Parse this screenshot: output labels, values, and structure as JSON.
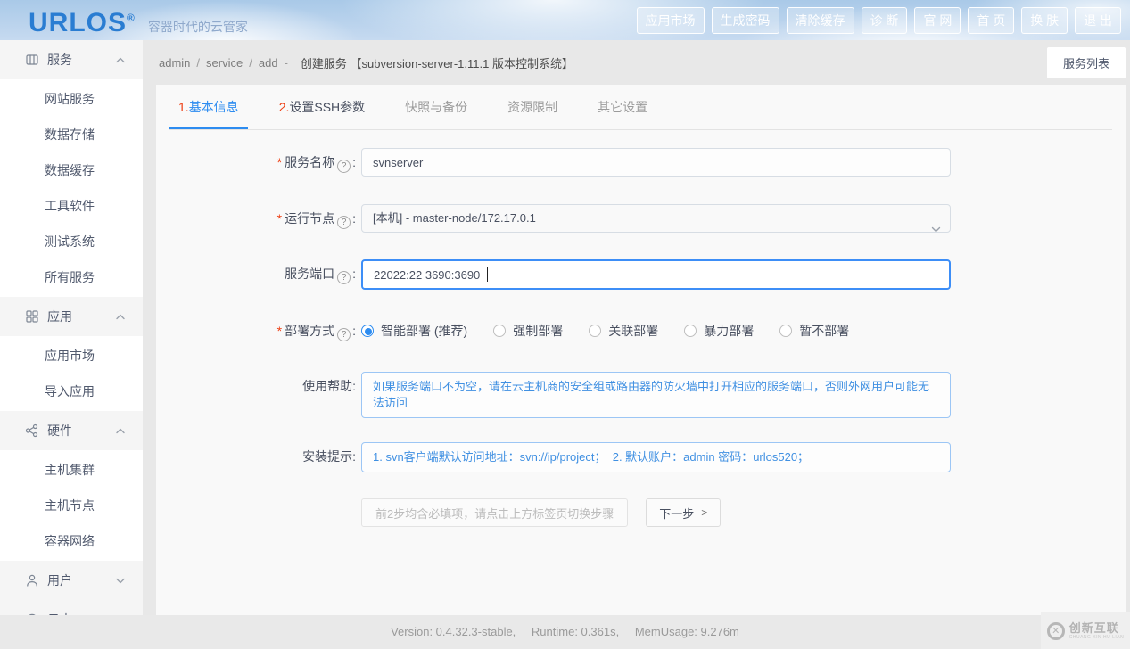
{
  "header": {
    "logo": "URLOS",
    "logo_reg": "®",
    "tagline": "容器时代的云管家",
    "buttons": [
      "应用市场",
      "生成密码",
      "清除缓存",
      "诊 断",
      "官 网",
      "首 页",
      "换 肤",
      "退 出"
    ]
  },
  "sidebar": {
    "groups": [
      {
        "label": "服务",
        "expanded": true,
        "items": [
          "网站服务",
          "数据存储",
          "数据缓存",
          "工具软件",
          "测试系统",
          "所有服务"
        ]
      },
      {
        "label": "应用",
        "expanded": true,
        "items": [
          "应用市场",
          "导入应用"
        ]
      },
      {
        "label": "硬件",
        "expanded": true,
        "items": [
          "主机集群",
          "主机节点",
          "容器网络"
        ]
      },
      {
        "label": "用户",
        "expanded": false,
        "items": []
      },
      {
        "label": "日志",
        "expanded": false,
        "items": []
      }
    ]
  },
  "breadcrumb": {
    "items": [
      "admin",
      "service",
      "add"
    ],
    "sep": "/",
    "dash": "-",
    "title": "创建服务 【subversion-server-1.11.1 版本控制系统】"
  },
  "toolbar": {
    "service_list": "服务列表"
  },
  "tabs": [
    {
      "num": "1.",
      "label": "基本信息",
      "active": true
    },
    {
      "num": "2.",
      "label": "设置SSH参数",
      "active": false
    },
    {
      "label": "快照与备份",
      "active": false
    },
    {
      "label": "资源限制",
      "active": false
    },
    {
      "label": "其它设置",
      "active": false
    }
  ],
  "form": {
    "required_mark": "*",
    "help_glyph": "?",
    "service_name": {
      "label": "服务名称",
      "value": "svnserver"
    },
    "run_node": {
      "label": "运行节点",
      "value": "[本机] - master-node/172.17.0.1"
    },
    "service_port": {
      "label": "服务端口",
      "value": "22022:22 3690:3690",
      "focused": true
    },
    "deploy": {
      "label": "部署方式",
      "options": [
        "智能部署 (推荐)",
        "强制部署",
        "关联部署",
        "暴力部署",
        "暂不部署"
      ],
      "selected_index": 0
    },
    "usage_help": {
      "label": "使用帮助",
      "text": "如果服务端口不为空，请在云主机商的安全组或路由器的防火墙中打开相应的服务端口，否则外网用户可能无法访问"
    },
    "install_tip": {
      "label": "安装提示",
      "text": "1. svn客户端默认访问地址：svn://ip/project；  2. 默认账户：admin 密码：urlos520；"
    }
  },
  "actions": {
    "disabled_note": "前2步均含必填项，请点击上方标签页切换步骤",
    "next": "下一步",
    "next_arrow": ">"
  },
  "footer": {
    "version": "Version: 0.4.32.3-stable,",
    "runtime": "Runtime: 0.361s,",
    "mem_usage": "MemUsage: 9.276m"
  },
  "watermark": {
    "glyph": "✕",
    "title": "创新互联",
    "subtitle": "CHUANG XIN HU LIAN"
  },
  "colors": {
    "accent": "#2d8cf0",
    "required": "#ed3f14",
    "info_text": "#4090e2",
    "logo": "#2a7dd2"
  }
}
